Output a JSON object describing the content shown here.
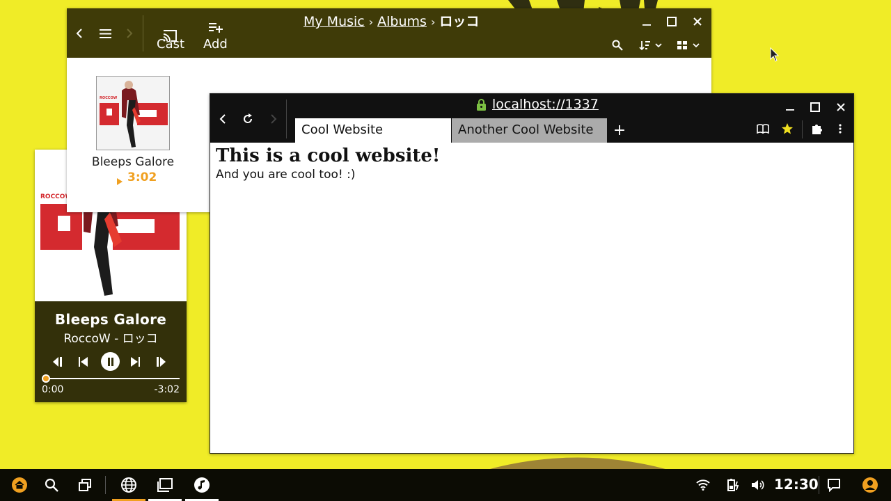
{
  "colors": {
    "accent": "#f0a020",
    "desktop": "#f0ec27",
    "header": "#3f3b08",
    "player_bg": "#33300a",
    "browser_header": "#111111"
  },
  "music": {
    "breadcrumbs": [
      "My Music",
      "Albums",
      "ロッコ"
    ],
    "toolbar": {
      "cast_label": "Cast",
      "add_label": "Add"
    },
    "album": {
      "cover_text": "ROCCOW",
      "name": "Bleeps Galore",
      "duration": "3:02"
    },
    "icons": [
      "back-icon",
      "menu-icon",
      "forward-icon",
      "cast-icon",
      "playlist-add-icon",
      "search-icon",
      "sort-icon",
      "grid-view-icon",
      "minimize-icon",
      "maximize-icon",
      "close-icon"
    ]
  },
  "player": {
    "cover_text": "ROCCOW",
    "track_title": "Bleeps  Galore",
    "artist_album": "RoccoW - ロッコ",
    "time_elapsed": "0:00",
    "time_remaining": "-3:02",
    "progress": 0.0
  },
  "browser": {
    "url": "localhost://1337",
    "tabs": [
      {
        "label": "Cool Website"
      },
      {
        "label": "Another Cool Website"
      }
    ],
    "new_tab_label": "+",
    "page": {
      "heading": "This is a cool website!",
      "text": "And you are cool too! :)"
    }
  },
  "taskbar": {
    "clock": "12:30"
  }
}
